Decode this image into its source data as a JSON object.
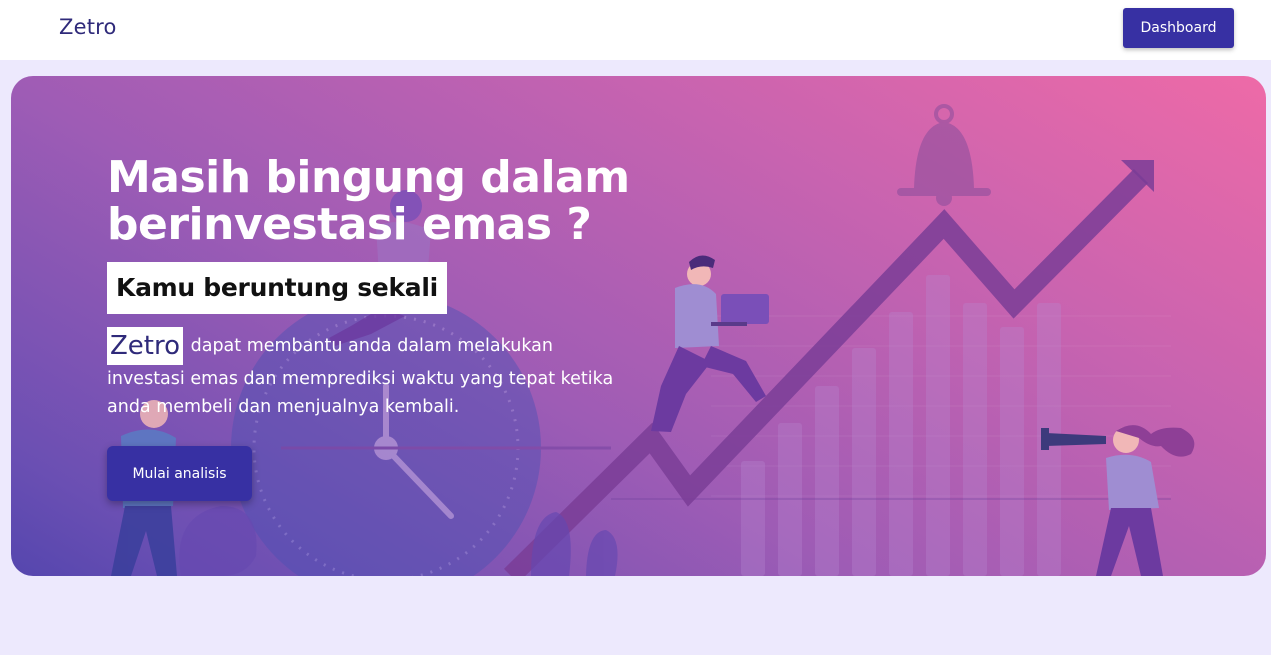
{
  "navbar": {
    "brand": "Zetro",
    "dashboard_label": "Dashboard"
  },
  "hero": {
    "title": "Masih bingung dalam berinvestasi emas ?",
    "badge": "Kamu beruntung sekali",
    "brand_inline": "Zetro",
    "description": "dapat membantu anda dalam melakukan investasi emas dan memprediksi waktu yang tepat ketika anda membeli dan menjualnya kembali.",
    "cta_label": "Mulai analisis",
    "illustration_icons": [
      "clock-icon",
      "bell-icon",
      "trend-arrow-icon",
      "laptop-icon",
      "telescope-icon",
      "leaf-icon"
    ]
  },
  "colors": {
    "primary": "#3730a3",
    "page_background": "#ede9fd",
    "gradient_start": "#ee6aa7",
    "gradient_end": "#5546ae",
    "brand_text": "#2f2a7a"
  }
}
